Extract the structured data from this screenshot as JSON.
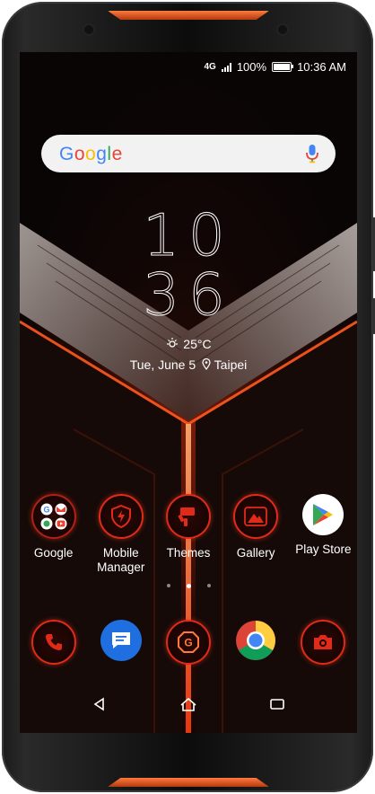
{
  "status_bar": {
    "network": "4G",
    "battery_percent_label": "100%",
    "battery_level": 1.0,
    "time": "10:36 AM"
  },
  "search": {
    "logo_text": "Google",
    "mic_icon": "mic-icon"
  },
  "clock": {
    "hours": "10",
    "minutes": "36"
  },
  "weather": {
    "icon": "sun-icon",
    "temperature": "25°C"
  },
  "date_location": {
    "date": "Tue, June 5",
    "location": "Taipei",
    "location_icon": "location-pin-icon"
  },
  "home_apps": [
    {
      "label": "Google",
      "icon": "google-folder-icon"
    },
    {
      "label": "Mobile Manager",
      "icon": "mobile-manager-icon"
    },
    {
      "label": "Themes",
      "icon": "themes-icon"
    },
    {
      "label": "Gallery",
      "icon": "gallery-icon"
    },
    {
      "label": "Play Store",
      "icon": "play-store-icon"
    }
  ],
  "page_indicator": {
    "count": 3,
    "active_index": 1
  },
  "dock": [
    {
      "icon": "phone-icon"
    },
    {
      "icon": "messages-icon"
    },
    {
      "icon": "game-center-icon"
    },
    {
      "icon": "chrome-icon"
    },
    {
      "icon": "camera-icon"
    }
  ],
  "navigation": [
    {
      "icon": "back-icon"
    },
    {
      "icon": "home-icon"
    },
    {
      "icon": "recents-icon"
    }
  ],
  "colors": {
    "accent": "#e02a1a",
    "copper": "#ff7a3c",
    "google_blue": "#4285F4",
    "google_red": "#EA4335",
    "google_yellow": "#FBBC05",
    "google_green": "#34A853"
  }
}
